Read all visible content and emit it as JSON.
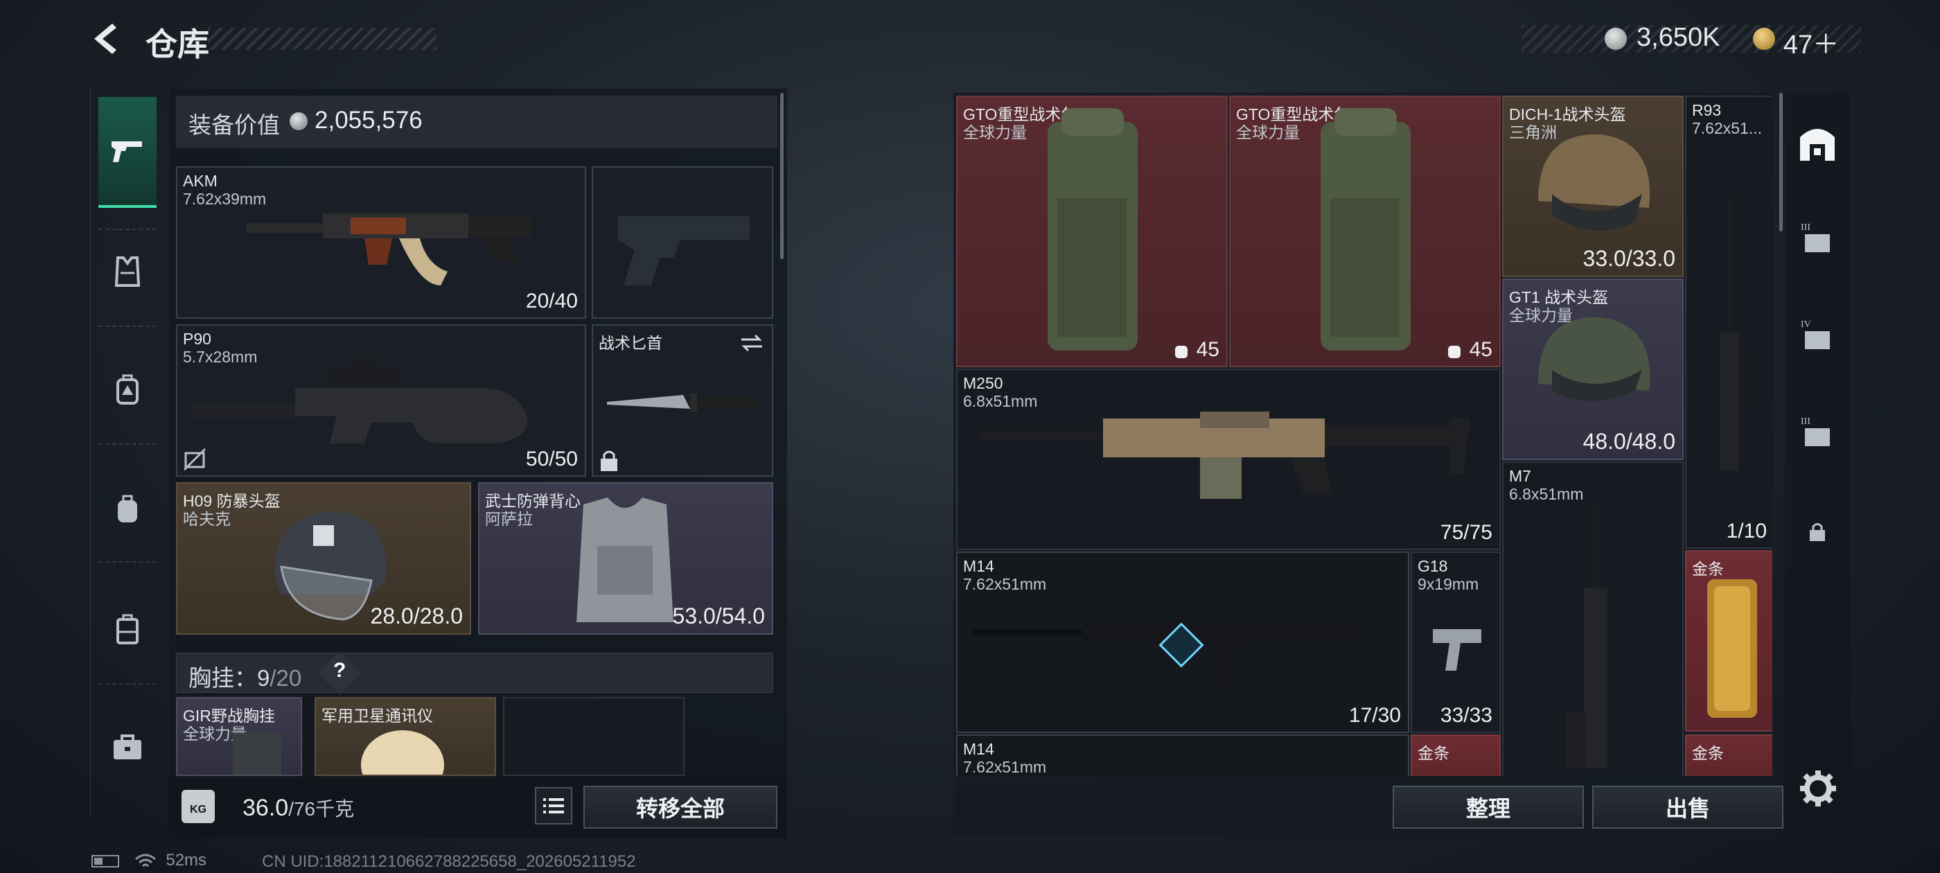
{
  "header": {
    "title": "仓库",
    "currency1": "3,650K",
    "currency2": "47＋"
  },
  "nav": {
    "left": [
      {
        "icon": "pistol-icon"
      },
      {
        "icon": "vest-icon"
      },
      {
        "icon": "backpack-small-icon"
      },
      {
        "icon": "backpack-icon"
      },
      {
        "icon": "case-icon"
      },
      {
        "icon": "toolbox-icon"
      }
    ],
    "right": [
      {
        "icon": "storage-home-icon"
      },
      {
        "icon": "tier-3-storage-icon"
      },
      {
        "icon": "tier-4-storage-icon"
      },
      {
        "icon": "tier-3-storage-icon"
      },
      {
        "icon": "lock-icon"
      }
    ]
  },
  "loadout": {
    "equip_label": "装备价值",
    "equip_value": "2,055,576",
    "primary": {
      "name": "AKM",
      "ammo": "7.62x39mm",
      "capacity": "20/40"
    },
    "secondary": {
      "name": "P90",
      "ammo": "5.7x28mm",
      "capacity": "50/50"
    },
    "melee": {
      "name": "战术匕首"
    },
    "helmet": {
      "name": "H09 防暴头盔",
      "brand": "哈夫克",
      "durability": "28.0/28.0"
    },
    "armor": {
      "name": "武士防弹背心",
      "brand": "阿萨拉",
      "durability": "53.0/54.0"
    },
    "chest_label": "胸挂：",
    "chest_used": "9",
    "chest_total": "/20",
    "chest_help": "?",
    "chest_items": [
      {
        "name": "GIR野战胸挂",
        "brand": "全球力量"
      },
      {
        "name": "军用卫星通讯仪"
      }
    ],
    "weight": "36.0",
    "weight_cap": "/76千克",
    "kg_badge": "KG",
    "transfer_label": "转移全部"
  },
  "storage": {
    "items": [
      {
        "name": "GTO重型战术包",
        "brand": "全球力量",
        "count": "45"
      },
      {
        "name": "GTO重型战术包",
        "brand": "全球力量",
        "count": "45"
      },
      {
        "name": "DICH-1战术头盔",
        "brand": "三角洲",
        "durability": "33.0/33.0"
      },
      {
        "name": "R93",
        "ammo": "7.62x51...",
        "capacity": "1/10"
      },
      {
        "name": "GT1 战术头盔",
        "brand": "全球力量",
        "durability": "48.0/48.0"
      },
      {
        "name": "M250",
        "ammo": "6.8x51mm",
        "capacity": "75/75"
      },
      {
        "name": "M7",
        "ammo": "6.8x51mm"
      },
      {
        "name": "M14",
        "ammo": "7.62x51mm",
        "capacity": "17/30"
      },
      {
        "name": "G18",
        "ammo": "9x19mm",
        "capacity": "33/33"
      },
      {
        "name": "金条"
      },
      {
        "name": "M14",
        "ammo": "7.62x51mm"
      },
      {
        "name": "金条"
      },
      {
        "name": "金条"
      }
    ],
    "sort_label": "整理",
    "sell_label": "出售"
  },
  "status": {
    "ping": "52ms",
    "uid": "CN UID:18821121066278822565​8_202605211952"
  },
  "colors": {
    "accent": "#3ee0a6",
    "red_bg": "#5a2b30",
    "gold_bg": "#6e2c33",
    "brown_bg": "#4a3e32",
    "purple_bg": "#3c3b4d"
  }
}
